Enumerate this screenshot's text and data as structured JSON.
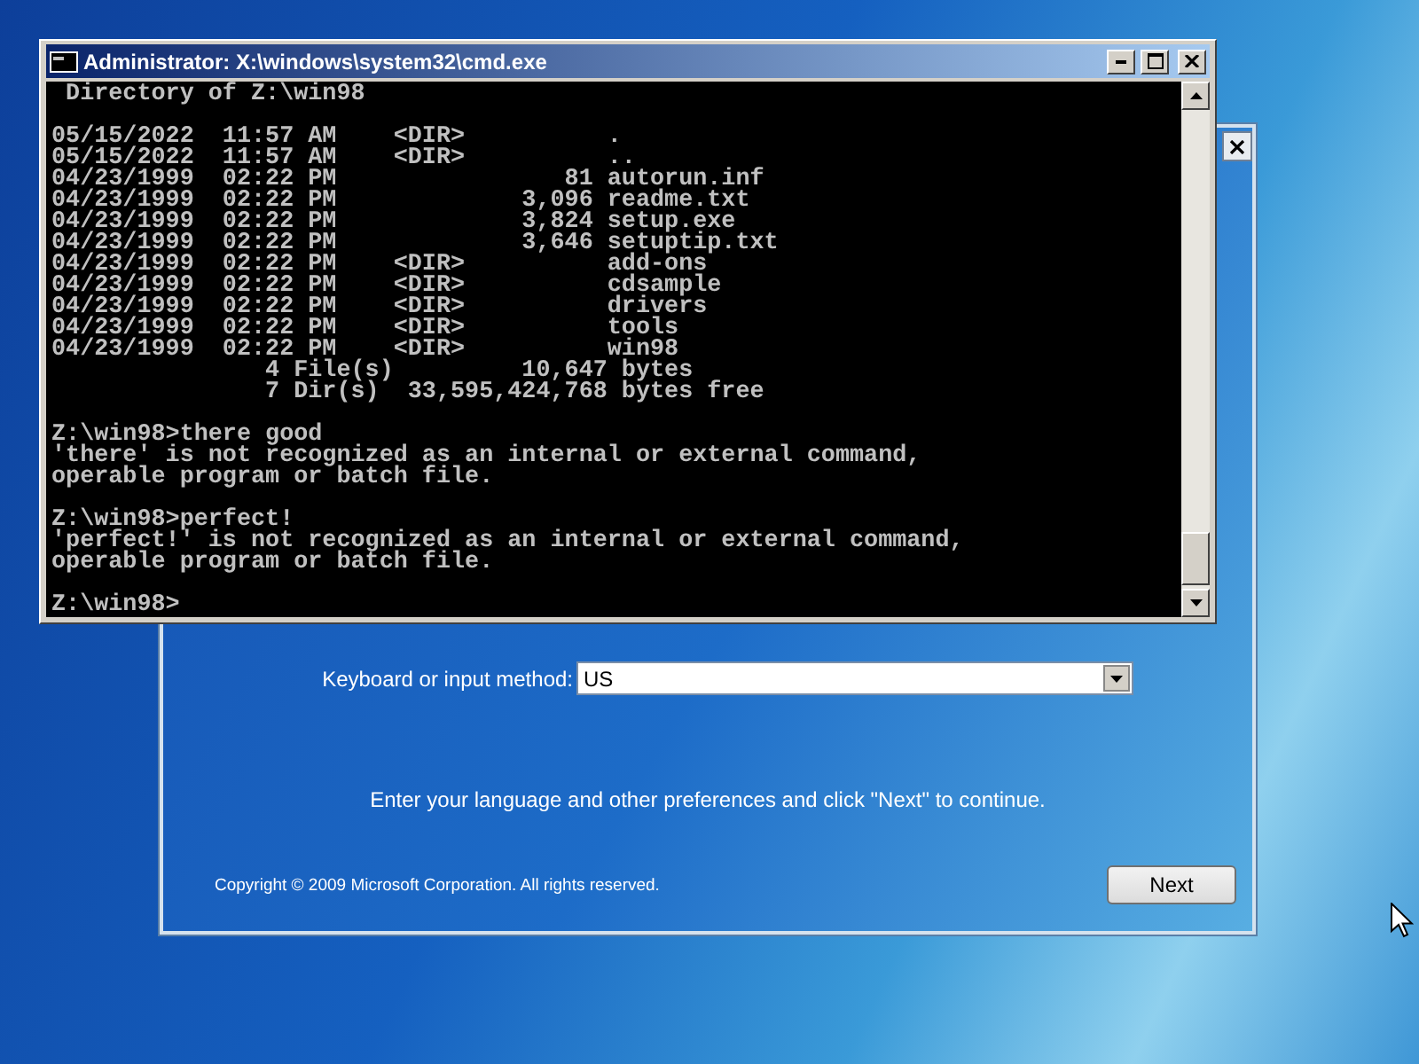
{
  "cmd_window": {
    "title": "Administrator: X:\\windows\\system32\\cmd.exe",
    "console_blocks": [
      [
        " Directory of Z:\\win98"
      ],
      [
        "05/15/2022  11:57 AM    <DIR>          .",
        "05/15/2022  11:57 AM    <DIR>          ..",
        "04/23/1999  02:22 PM                81 autorun.inf",
        "04/23/1999  02:22 PM             3,096 readme.txt",
        "04/23/1999  02:22 PM             3,824 setup.exe",
        "04/23/1999  02:22 PM             3,646 setuptip.txt",
        "04/23/1999  02:22 PM    <DIR>          add-ons",
        "04/23/1999  02:22 PM    <DIR>          cdsample",
        "04/23/1999  02:22 PM    <DIR>          drivers",
        "04/23/1999  02:22 PM    <DIR>          tools",
        "04/23/1999  02:22 PM    <DIR>          win98",
        "               4 File(s)         10,647 bytes",
        "               7 Dir(s)  33,595,424,768 bytes free"
      ],
      [
        "Z:\\win98>there good",
        "'there' is not recognized as an internal or external command,",
        "operable program or batch file."
      ],
      [
        "Z:\\win98>perfect!",
        "'perfect!' is not recognized as an internal or external command,",
        "operable program or batch file."
      ],
      [
        "Z:\\win98>"
      ]
    ]
  },
  "setup_window": {
    "keyboard_label": "Keyboard or input method:",
    "keyboard_value": "US",
    "instruction": "Enter your language and other preferences and click \"Next\" to continue.",
    "copyright": "Copyright © 2009 Microsoft Corporation. All rights reserved.",
    "next_button": "Next"
  }
}
